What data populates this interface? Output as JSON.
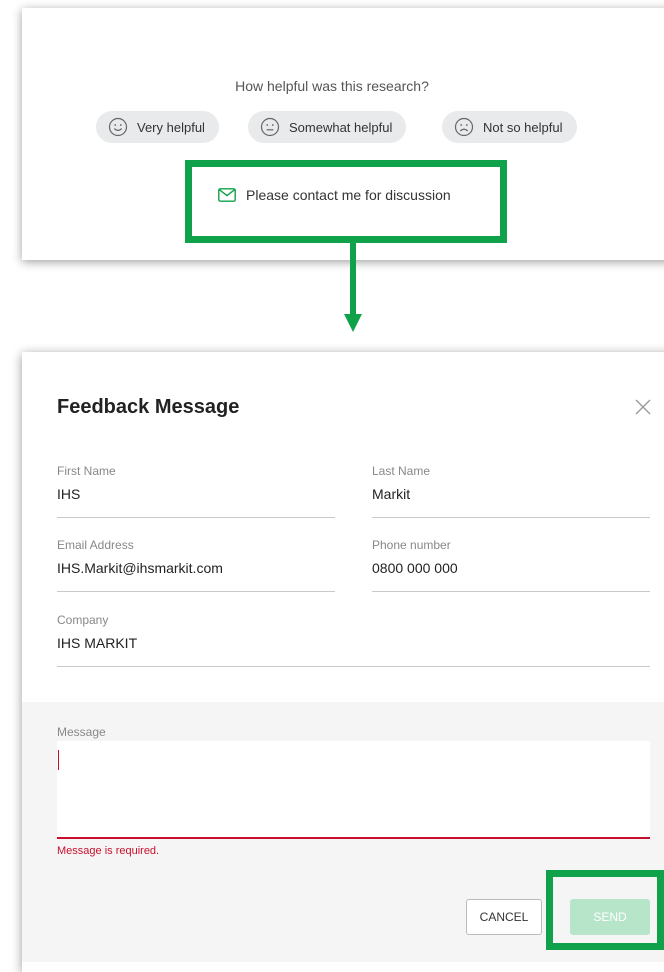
{
  "feedback": {
    "question": "How helpful was this research?",
    "ratings": [
      {
        "label": "Very helpful",
        "icon": "smile-face-icon"
      },
      {
        "label": "Somewhat helpful",
        "icon": "neutral-face-icon"
      },
      {
        "label": "Not so helpful",
        "icon": "sad-face-icon"
      }
    ],
    "contact_label": "Please contact me for discussion",
    "contact_icon": "mail-icon"
  },
  "modal": {
    "title": "Feedback Message",
    "close_icon": "close-icon",
    "fields": {
      "first_name": {
        "label": "First Name",
        "value": "IHS"
      },
      "last_name": {
        "label": "Last Name",
        "value": "Markit"
      },
      "email": {
        "label": "Email Address",
        "value": "IHS.Markit@ihsmarkit.com"
      },
      "phone": {
        "label": "Phone number",
        "value": "0800 000 000"
      },
      "company": {
        "label": "Company",
        "value": "IHS MARKIT"
      }
    },
    "message": {
      "label": "Message",
      "value": "",
      "error": "Message is required."
    },
    "buttons": {
      "cancel": "CANCEL",
      "send": "SEND"
    }
  },
  "colors": {
    "annotation_green": "#10a24a",
    "error_red": "#c8102e",
    "send_disabled": "#b7e5c9"
  }
}
